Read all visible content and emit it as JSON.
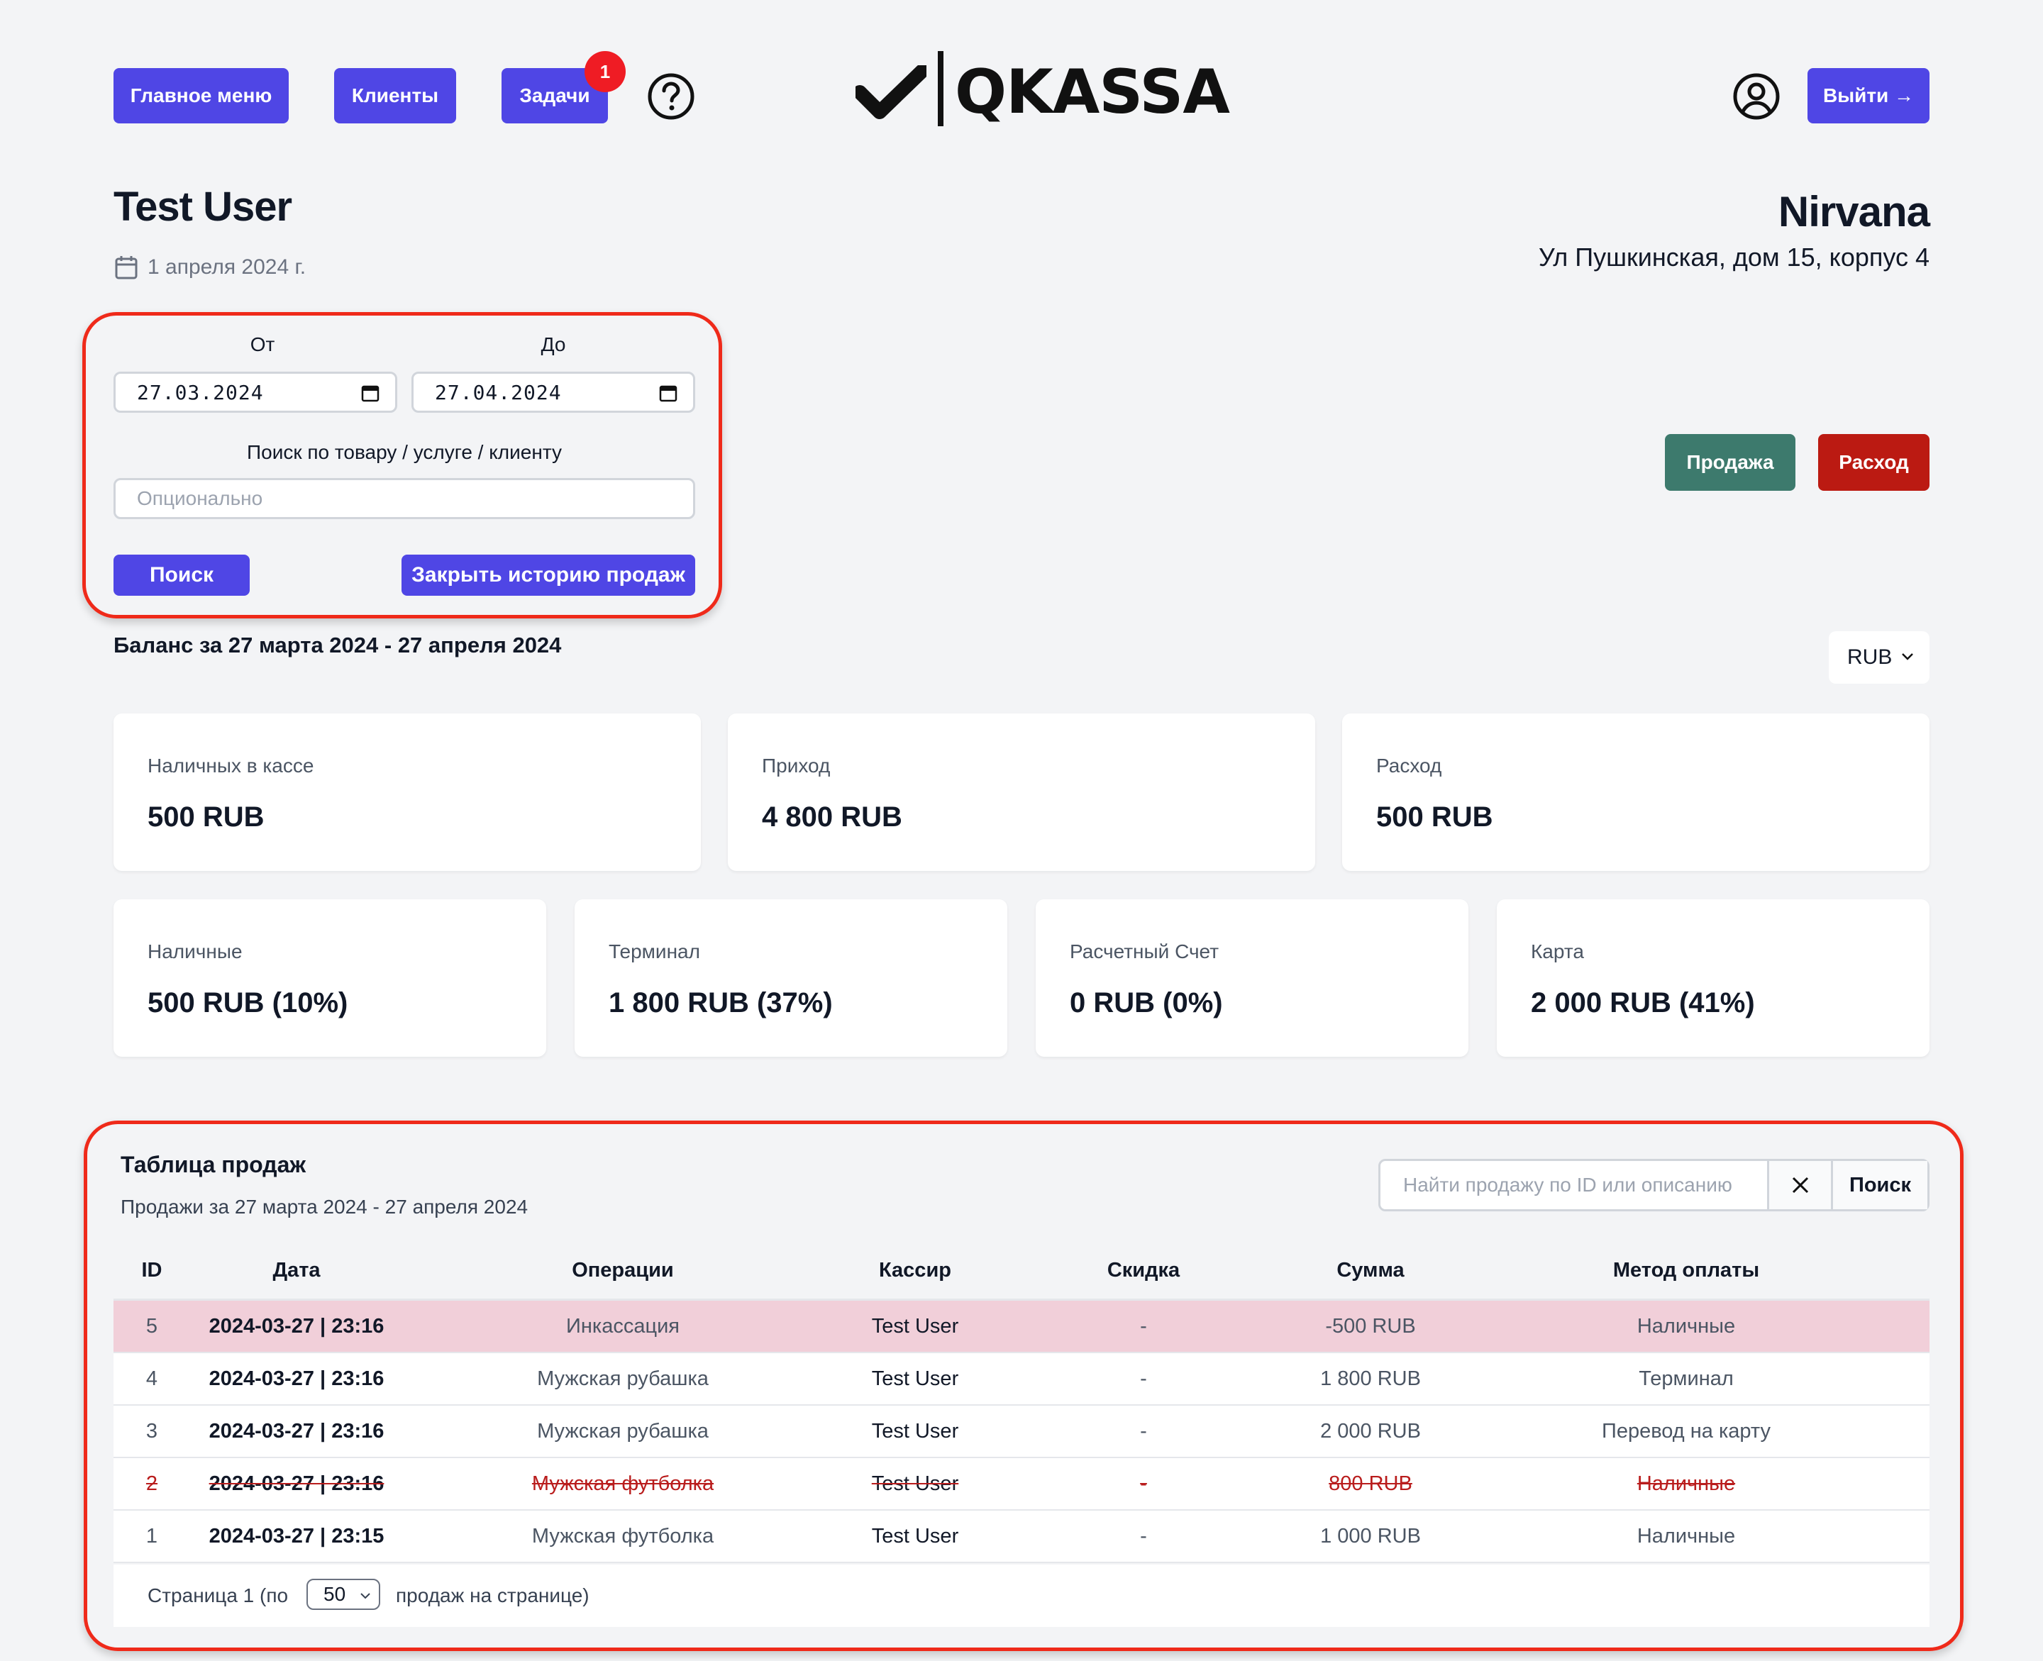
{
  "nav": {
    "main_menu": "Главное меню",
    "clients": "Клиенты",
    "tasks": "Задачи",
    "tasks_badge": "1",
    "logout": "Выйти →"
  },
  "logo": {
    "text": "QKASSA"
  },
  "user": {
    "name": "Test User",
    "date": "1 апреля 2024 г."
  },
  "shop": {
    "name": "Nirvana",
    "address": "Ул Пушкинская, дом 15, корпус 4"
  },
  "filter": {
    "from_label": "От",
    "to_label": "До",
    "from_value": "27.03.2024",
    "to_value": "27.04.2024",
    "search_label": "Поиск по товару / услуге / клиенту",
    "search_placeholder": "Опционально",
    "search_button": "Поиск",
    "close_history_button": "Закрыть историю продаж"
  },
  "actions": {
    "sale": "Продажа",
    "expense": "Расход"
  },
  "balance": {
    "title": "Баланс за 27 марта 2024 - 27 апреля 2024",
    "currency": "RUB",
    "cards_top": [
      {
        "label": "Наличных в кассе",
        "value": "500  RUB"
      },
      {
        "label": "Приход",
        "value": "4 800  RUB"
      },
      {
        "label": "Расход",
        "value": "500  RUB"
      }
    ],
    "cards_bottom": [
      {
        "label": "Наличные",
        "value": "500  RUB  (10%)"
      },
      {
        "label": "Терминал",
        "value": "1 800  RUB  (37%)"
      },
      {
        "label": "Расчетный Счет",
        "value": "0  RUB  (0%)"
      },
      {
        "label": "Карта",
        "value": "2 000  RUB  (41%)"
      }
    ]
  },
  "sales": {
    "title": "Таблица продаж",
    "subtitle": "Продажи за 27 марта 2024 - 27 апреля 2024",
    "search_placeholder": "Найти продажу по ID или описанию",
    "search_button": "Поиск",
    "columns": [
      "ID",
      "Дата",
      "Операции",
      "Кассир",
      "Скидка",
      "Сумма",
      "Метод оплаты"
    ],
    "rows": [
      {
        "id": "5",
        "date": "2024-03-27 | 23:16",
        "op": "Инкассация",
        "cashier": "Test User",
        "discount": "-",
        "sum": "-500 RUB",
        "method": "Наличные",
        "state": "highlight"
      },
      {
        "id": "4",
        "date": "2024-03-27 | 23:16",
        "op": "Мужская рубашка",
        "cashier": "Test User",
        "discount": "-",
        "sum": "1 800 RUB",
        "method": "Терминал",
        "state": "normal"
      },
      {
        "id": "3",
        "date": "2024-03-27 | 23:16",
        "op": "Мужская рубашка",
        "cashier": "Test User",
        "discount": "-",
        "sum": "2 000 RUB",
        "method": "Перевод на карту",
        "state": "normal"
      },
      {
        "id": "2",
        "date": "2024-03-27 | 23:16",
        "op": "Мужская футболка",
        "cashier": "Test User",
        "discount": "-",
        "sum": "800 RUB",
        "method": "Наличные",
        "state": "cancelled"
      },
      {
        "id": "1",
        "date": "2024-03-27 | 23:15",
        "op": "Мужская футболка",
        "cashier": "Test User",
        "discount": "-",
        "sum": "1 000 RUB",
        "method": "Наличные",
        "state": "normal"
      }
    ],
    "pager": {
      "prefix": "Страница 1 (по",
      "per_page": "50",
      "suffix": "продаж на странице)"
    }
  }
}
